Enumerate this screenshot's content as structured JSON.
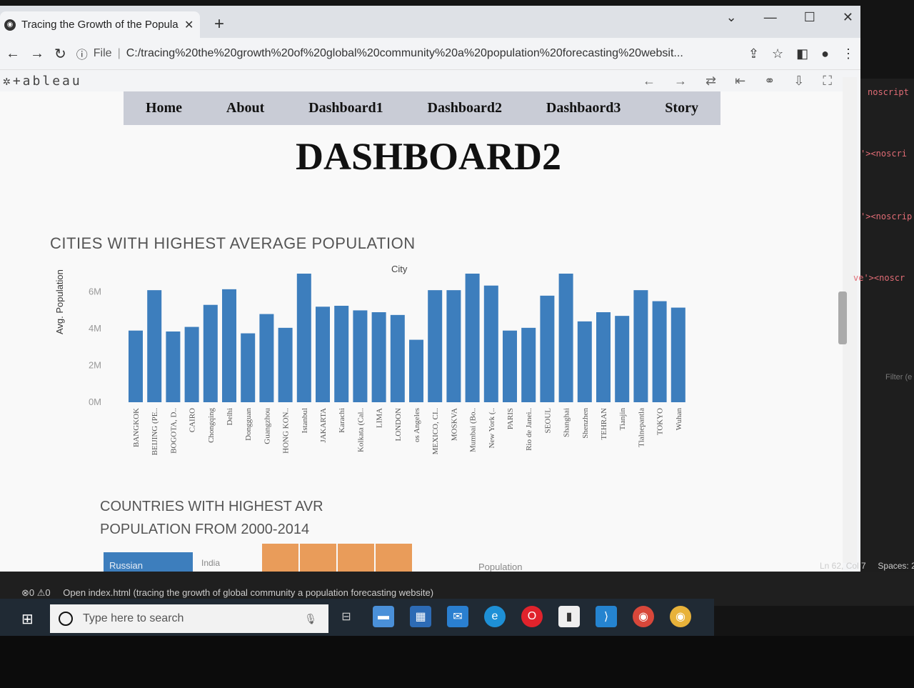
{
  "browser": {
    "tab_title": "Tracing the Growth of the Popula",
    "tab_close": "✕",
    "new_tab": "+",
    "url_label": "File",
    "url": "C:/tracing%20the%20growth%20of%20global%20community%20a%20population%20forecasting%20websit...",
    "window_controls": [
      "⌄",
      "—",
      "☐",
      "✕"
    ]
  },
  "tableau": {
    "logo": "+ableau"
  },
  "nav": {
    "items": [
      "Home",
      "About",
      "Dashboard1",
      "Dashboard2",
      "Dashbaord3",
      "Story"
    ]
  },
  "page": {
    "title": "DASHBOARD2"
  },
  "chart1": {
    "title": "CITIES WITH HIGHEST AVERAGE POPULATION",
    "column_header": "City",
    "y_axis_label": "Avg. Population"
  },
  "chart_data": {
    "type": "bar",
    "title": "CITIES WITH HIGHEST AVERAGE POPULATION",
    "xlabel": "City",
    "ylabel": "Avg. Population",
    "ylim": [
      0,
      7000000
    ],
    "y_ticks": [
      "0M",
      "2M",
      "4M",
      "6M"
    ],
    "y_tick_values": [
      0,
      2000000,
      4000000,
      6000000
    ],
    "categories": [
      "BANGKOK",
      "BEIJING (PE..",
      "BOGOTA, D..",
      "CAIRO",
      "Chongqing",
      "Delhi",
      "Dongguan",
      "Guangzhou",
      "HONG KON..",
      "Istanbul",
      "JAKARTA",
      "Karachi",
      "Kolkata (Cal..",
      "LIMA",
      "LONDON",
      "os Angeles",
      "MEXICO, CI..",
      "MOSKVA",
      "Mumbai (Bo..",
      "New York (..",
      "PARIS",
      "Rio de Janei..",
      "SEOUL",
      "Shanghai",
      "Shenzhen",
      "TEHRAN",
      "Tianjin",
      "Tlalnepantla",
      "TOKYO",
      "Wuhan"
    ],
    "values": [
      3900000,
      6100000,
      3850000,
      4100000,
      5300000,
      6150000,
      3750000,
      4800000,
      4050000,
      7400000,
      5200000,
      5250000,
      5000000,
      4900000,
      4750000,
      3400000,
      6100000,
      6100000,
      7700000,
      6350000,
      3900000,
      4050000,
      5800000,
      7900000,
      4400000,
      4900000,
      4700000,
      6100000,
      5500000,
      5150000
    ],
    "color": "#3d7ebd"
  },
  "chart2": {
    "title_line1": "COUNTRIES WITH HIGHEST AVR",
    "title_line2": "POPULATION FROM 2000-2014",
    "russia_label": "Russian Federation",
    "india_label": "India",
    "population_label": "Population"
  },
  "vscode": {
    "lines": [
      "noscript",
      "'><noscri",
      "'><noscrip",
      "ve'><noscr"
    ],
    "filter": "Filter (e",
    "status_problems": "⊗0 ⚠0",
    "status_open": "Open index.html (tracing the growth of global community a population forecasting website)",
    "status_position": "Ln 62, Col 7",
    "status_spaces": "Spaces: 2"
  },
  "taskbar": {
    "search_placeholder": "Type here to search"
  }
}
